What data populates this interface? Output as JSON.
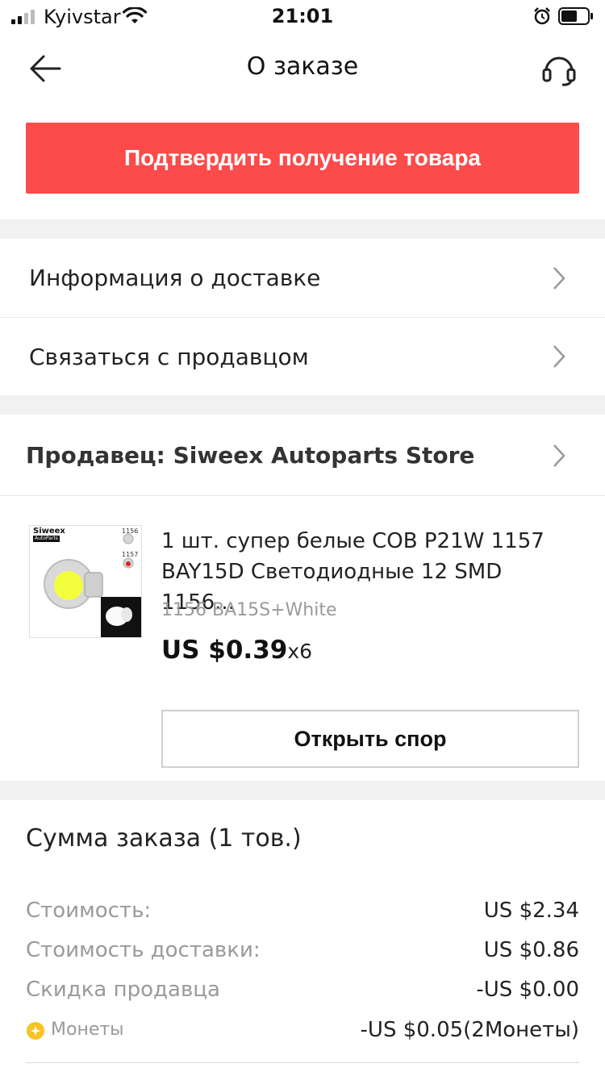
{
  "status_bar": {
    "carrier": "Kyivstar",
    "time": "21:01"
  },
  "header": {
    "title": "О заказе"
  },
  "confirm_button": {
    "label": "Подтвердить получение товара"
  },
  "menu": {
    "delivery_info": "Информация о доставке",
    "contact_seller": "Связаться с продавцом"
  },
  "seller": {
    "label": "Продавец: Siweex Autoparts Store"
  },
  "product": {
    "image_brand": "Siweex",
    "image_brand_sub": "AutoParts",
    "image_tag_1": "1156",
    "image_tag_2": "1157",
    "title": "1 шт. супер белые COB P21W 1157 BAY15D Светодиодные 12 SMD 1156...",
    "variant": "1156 BA15S+White",
    "price": "US $0.39",
    "quantity": "x6"
  },
  "dispute_button": {
    "label": "Открыть спор"
  },
  "summary": {
    "title": "Сумма заказа (1 тов.)",
    "rows": [
      {
        "label": "Стоимость:",
        "value": "US $2.34"
      },
      {
        "label": "Стоимость доставки:",
        "value": "US $0.86"
      },
      {
        "label": "Скидка продавца",
        "value": "-US $0.00"
      }
    ],
    "coins": {
      "label": "Монеты",
      "value": "-US $0.05(2Монеты)"
    }
  },
  "colors": {
    "accent": "#fc4b4b",
    "section_gap": "#f1f1f1",
    "muted_text": "#9a9a9a",
    "coin": "#f7c325"
  },
  "icons": [
    "back-arrow-icon",
    "headset-icon",
    "chevron-right-icon",
    "coin-icon",
    "signal-icon",
    "wifi-icon",
    "alarm-icon",
    "battery-icon"
  ]
}
